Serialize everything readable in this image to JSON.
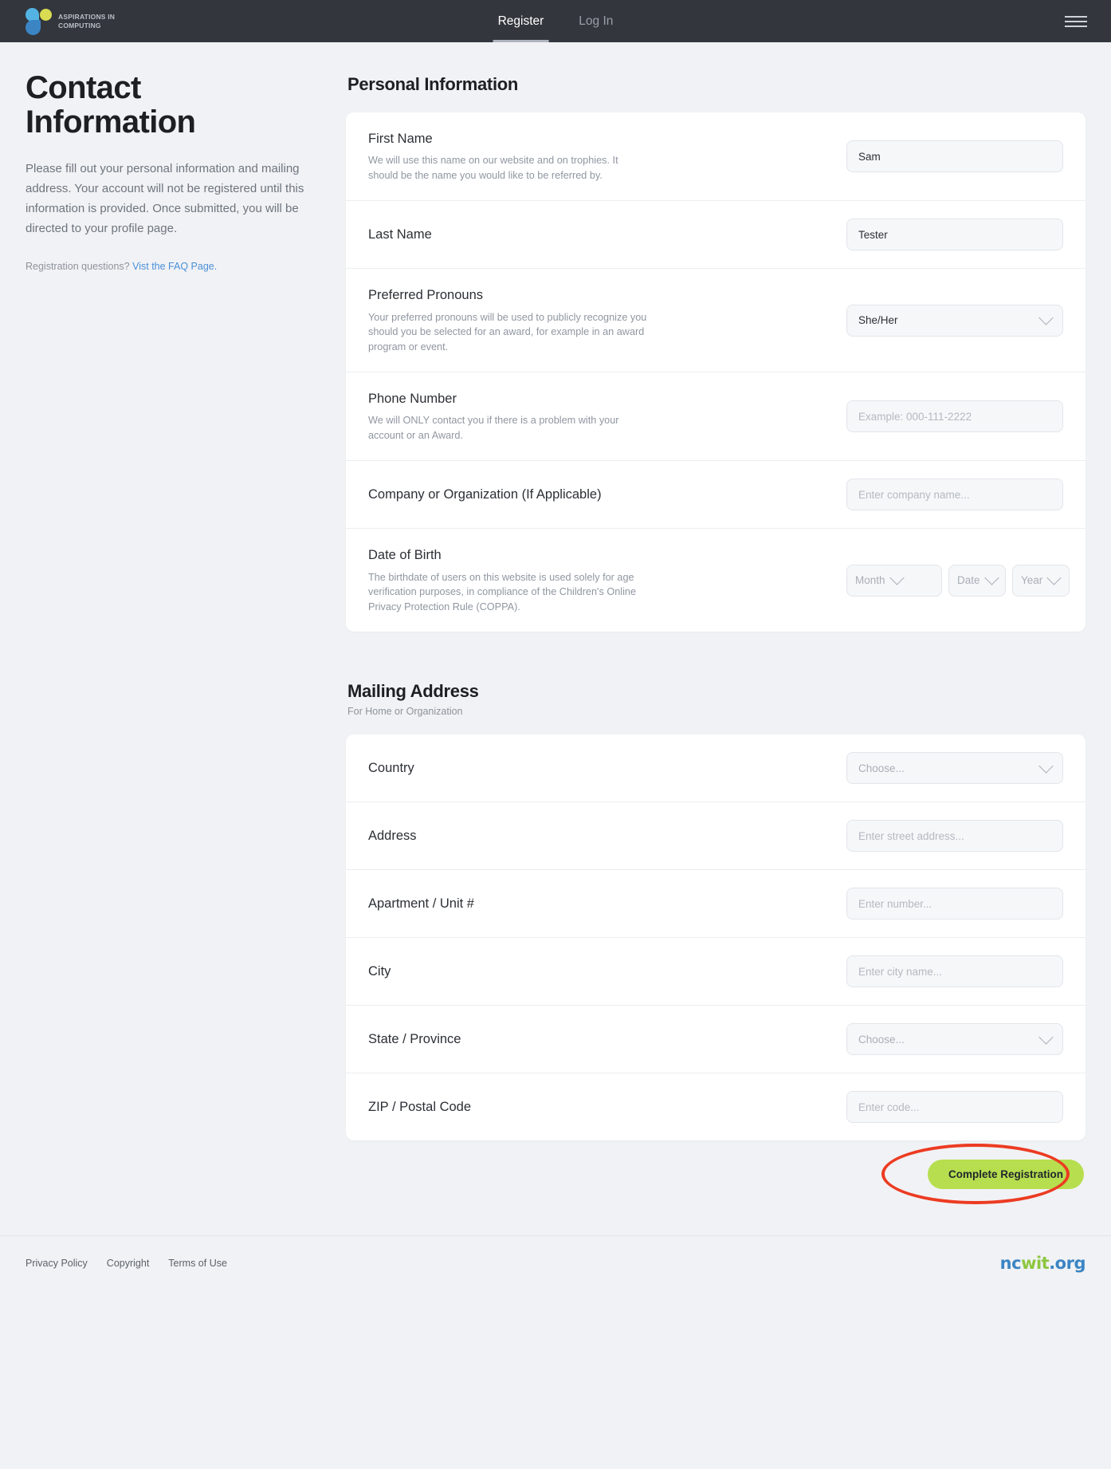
{
  "header": {
    "logo_line1": "ASPIRATIONS IN",
    "logo_line2": "COMPUTING",
    "nav": [
      {
        "label": "Register",
        "active": true
      },
      {
        "label": "Log In",
        "active": false
      }
    ],
    "menu_icon": "hamburger-menu-icon"
  },
  "intro": {
    "title": "Contact Information",
    "description": "Please fill out your personal information and mailing address. Your account will not be registered until this information is provided. Once submitted, you will be directed to your profile page.",
    "faq_prefix": "Registration questions?",
    "faq_link": "Vist the FAQ Page."
  },
  "personal": {
    "section_title": "Personal Information",
    "fields": [
      {
        "label": "First Name",
        "help": "We will use this name on our website and on trophies. It should be the name you would like to be referred by.",
        "type": "text",
        "value": "Sam",
        "placeholder": ""
      },
      {
        "label": "Last Name",
        "help": "",
        "type": "text",
        "value": "Tester",
        "placeholder": ""
      },
      {
        "label": "Preferred Pronouns",
        "help": "Your preferred pronouns will be used to publicly recognize you should you be selected for an award, for example in an award program or event.",
        "type": "select",
        "value": "She/Her",
        "placeholder": ""
      },
      {
        "label": "Phone Number",
        "help": "We will ONLY contact you if there is a problem with your account or an Award.",
        "type": "text",
        "value": "",
        "placeholder": "Example: 000-111-2222"
      },
      {
        "label": "Company or Organization (If Applicable)",
        "help": "",
        "type": "text",
        "value": "",
        "placeholder": "Enter company name..."
      },
      {
        "label": "Date of Birth",
        "help": "The birthdate of users on this website is used solely for age verification purposes, in compliance of the Children's Online Privacy Protection Rule (COPPA).",
        "type": "dob",
        "value": "",
        "placeholder": ""
      }
    ],
    "dob": {
      "month_placeholder": "Month",
      "date_placeholder": "Date",
      "year_placeholder": "Year"
    }
  },
  "mailing": {
    "section_title": "Mailing Address",
    "section_sub": "For Home or Organization",
    "fields": [
      {
        "label": "Country",
        "type": "select",
        "value": "Choose...",
        "is_placeholder": true
      },
      {
        "label": "Address",
        "type": "text",
        "placeholder": "Enter street address..."
      },
      {
        "label": "Apartment / Unit #",
        "type": "text",
        "placeholder": "Enter number..."
      },
      {
        "label": "City",
        "type": "text",
        "placeholder": "Enter city name..."
      },
      {
        "label": "State / Province",
        "type": "select",
        "value": "Choose...",
        "is_placeholder": true
      },
      {
        "label": "ZIP / Postal Code",
        "type": "text",
        "placeholder": "Enter code..."
      }
    ]
  },
  "submit": {
    "label": "Complete Registration",
    "button_color": "#b6de4f",
    "highlight_color": "#ec3b22"
  },
  "footer": {
    "links": [
      "Privacy Policy",
      "Copyright",
      "Terms of Use"
    ],
    "logo": {
      "part1": "nc",
      "part2": "wit",
      "part3": ".org"
    }
  }
}
